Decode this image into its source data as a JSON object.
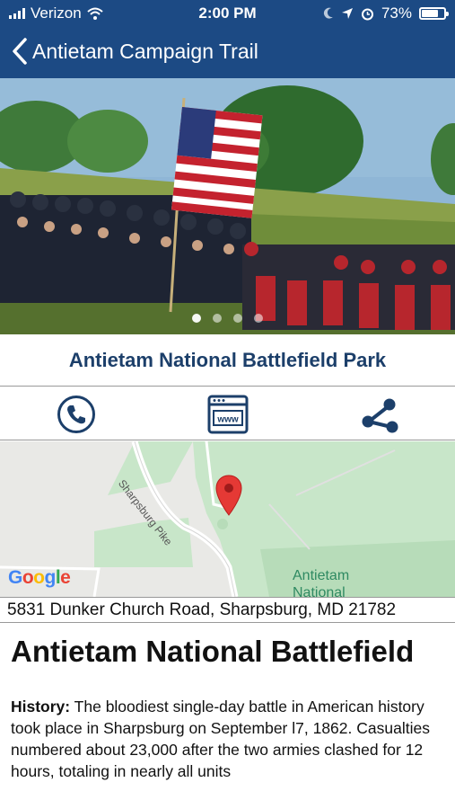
{
  "status_bar": {
    "carrier": "Verizon",
    "time": "2:00 PM",
    "battery": "73%",
    "battery_level": 0.73
  },
  "nav": {
    "back_icon": "chevron-left-icon",
    "title": "Antietam Campaign Trail"
  },
  "hero": {
    "carousel_pages": 4,
    "active_page": 0
  },
  "park": {
    "name": "Antietam National Battlefield Park"
  },
  "actions": [
    {
      "name": "call",
      "icon": "phone-icon"
    },
    {
      "name": "website",
      "icon": "www-icon"
    },
    {
      "name": "share",
      "icon": "share-icon"
    }
  ],
  "map": {
    "provider": "Google",
    "road_label": "Sharpsburg Pike",
    "area_label_line1": "Antietam",
    "area_label_line2": "National",
    "marker_color": "#e53935"
  },
  "address": "5831 Dunker Church Road, Sharpsburg, MD 21782",
  "article": {
    "title": "Antietam National Battlefield",
    "history_label": "History:",
    "history_text": " The bloodiest single-day battle in American history took place in Sharpsburg on September l7, 1862. Casualties numbered about 23,000 after the two armies clashed for 12 hours, totaling in nearly all units"
  },
  "colors": {
    "header": "#1c4a84",
    "park_name": "#1c3f6a",
    "icon": "#1c3f6a"
  }
}
